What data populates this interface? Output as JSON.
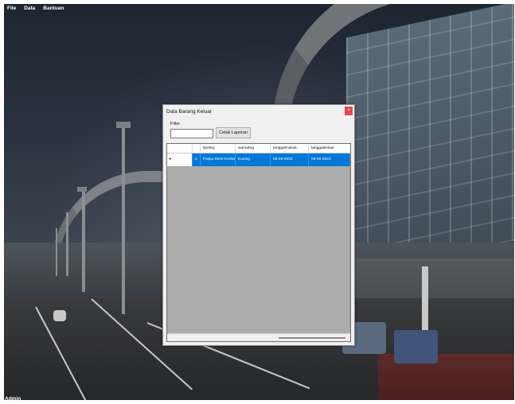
{
  "menu": {
    "items": [
      "File",
      "Data",
      "Bantuan"
    ]
  },
  "status": {
    "user": "Admin"
  },
  "dialog": {
    "title": "Data Barang Keluar",
    "close_label": "×",
    "filter_label": "Filter",
    "filter_value": "",
    "print_button": "Cetak Laporan",
    "grid": {
      "columns": [
        "",
        "tipebrg",
        "warnabrg",
        "tanggalmasuk",
        "tanggalkeluar"
      ],
      "rows": [
        {
          "marker": "▸",
          "col_a": "e",
          "tipebrg": "Paspu Merk Kerikio",
          "warnabrg": "Kuning",
          "tanggalmasuk": "05-09-2023",
          "tanggalkeluar": "05-09-2023"
        }
      ]
    }
  },
  "colors": {
    "selection": "#0078d7",
    "close": "#e5474b",
    "grid_bg": "#ababab"
  }
}
